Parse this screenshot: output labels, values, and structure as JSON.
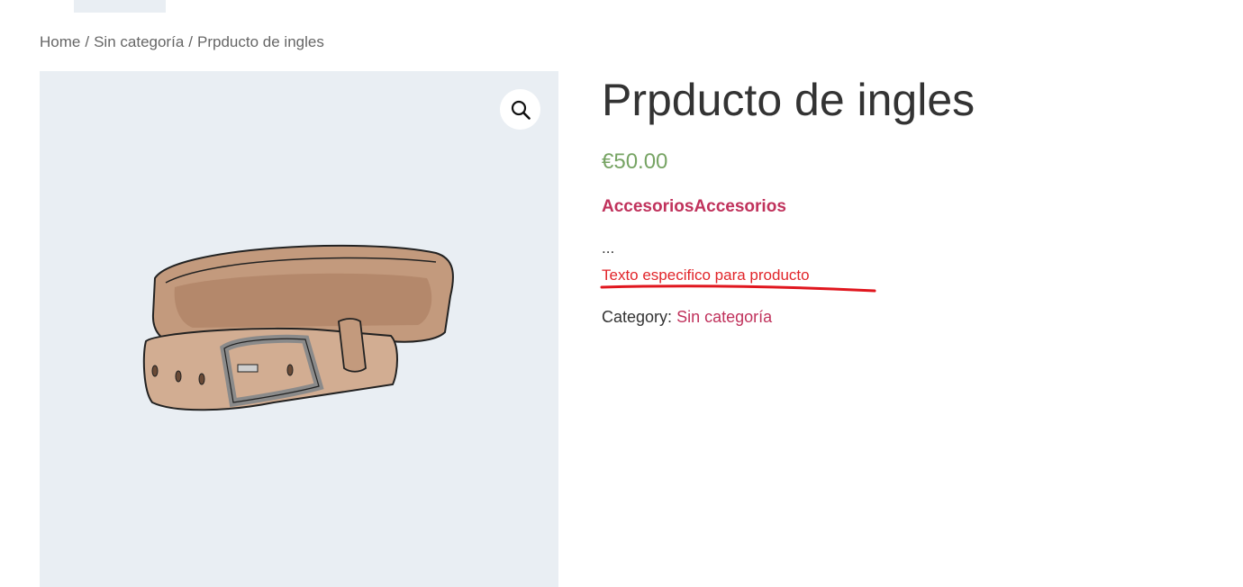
{
  "breadcrumb": {
    "home": "Home",
    "category": "Sin categoría",
    "current": "Prpducto de ingles",
    "separator": "/"
  },
  "gallery": {
    "zoom_icon": "magnifier-icon",
    "image": "leather-belt"
  },
  "product": {
    "title": "Prpducto de ingles",
    "price": "€50.00",
    "attribute": "AccesoriosAccesorios",
    "ellipsis": "...",
    "custom_text": "Texto especifico para producto",
    "category_label": "Category:",
    "category_link": "Sin categoría"
  },
  "colors": {
    "gallery_bg": "#e9eef3",
    "price": "#77a464",
    "link": "#c0325c",
    "custom_text": "#e1252a",
    "annotation_underline": "#e0161e"
  }
}
